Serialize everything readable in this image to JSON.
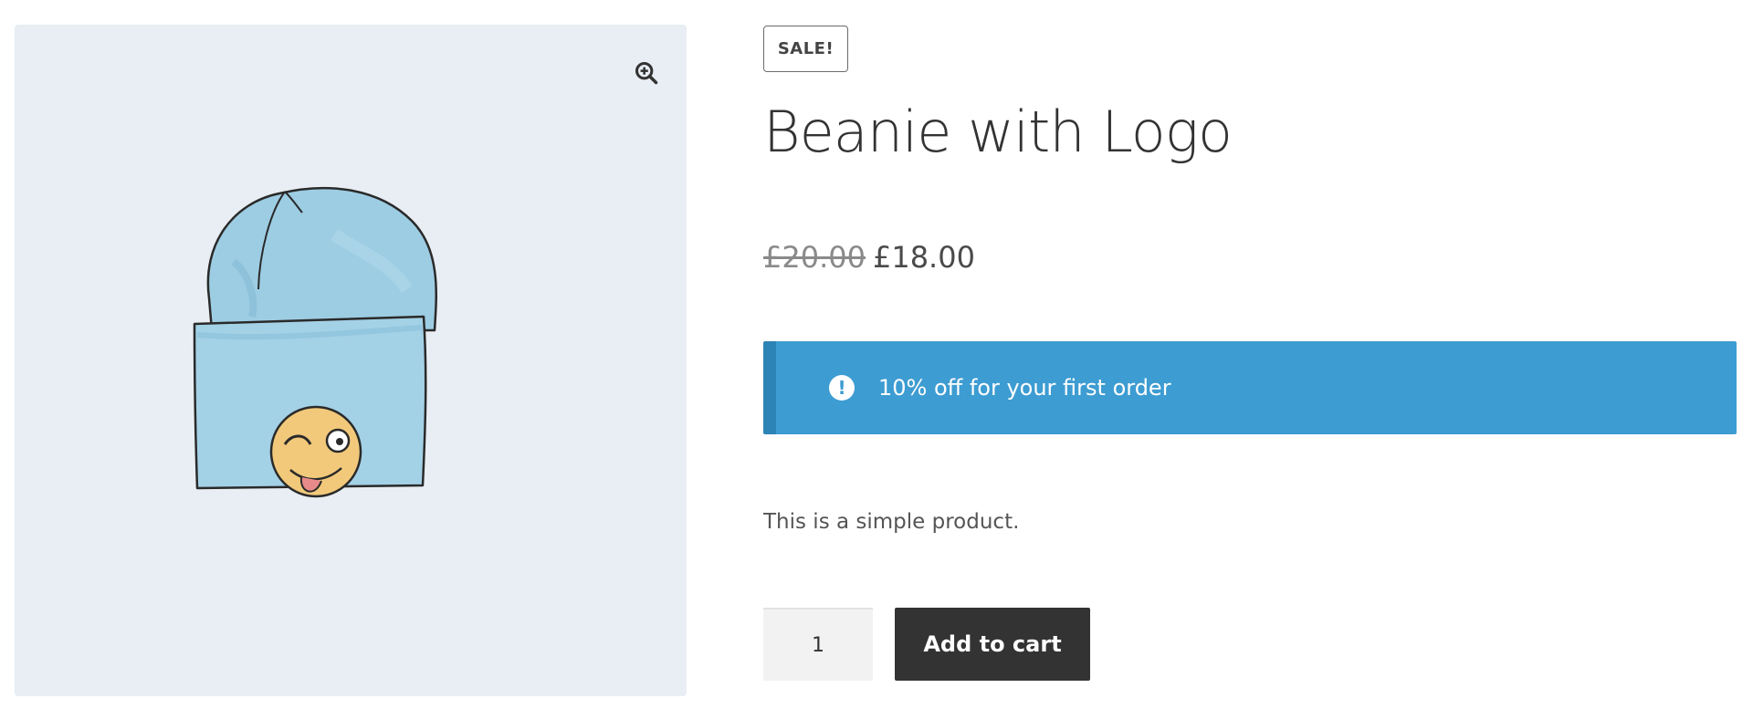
{
  "gallery": {
    "background": "#e8eef3",
    "zoom_icon": "zoom-in-magnifier-icon",
    "image_subject": "beanie-illustration"
  },
  "product": {
    "badge": "SALE!",
    "title": "Beanie with Logo",
    "price_old": "£20.00",
    "price_new": "£18.00",
    "description": "This is a simple product."
  },
  "notice": {
    "icon": "info-exclamation-icon",
    "text": "10% off for your first order",
    "color": "#3d9cd2",
    "accent": "#2c83b6"
  },
  "cart": {
    "quantity": "1",
    "add_label": "Add to cart",
    "button_color": "#333333"
  }
}
